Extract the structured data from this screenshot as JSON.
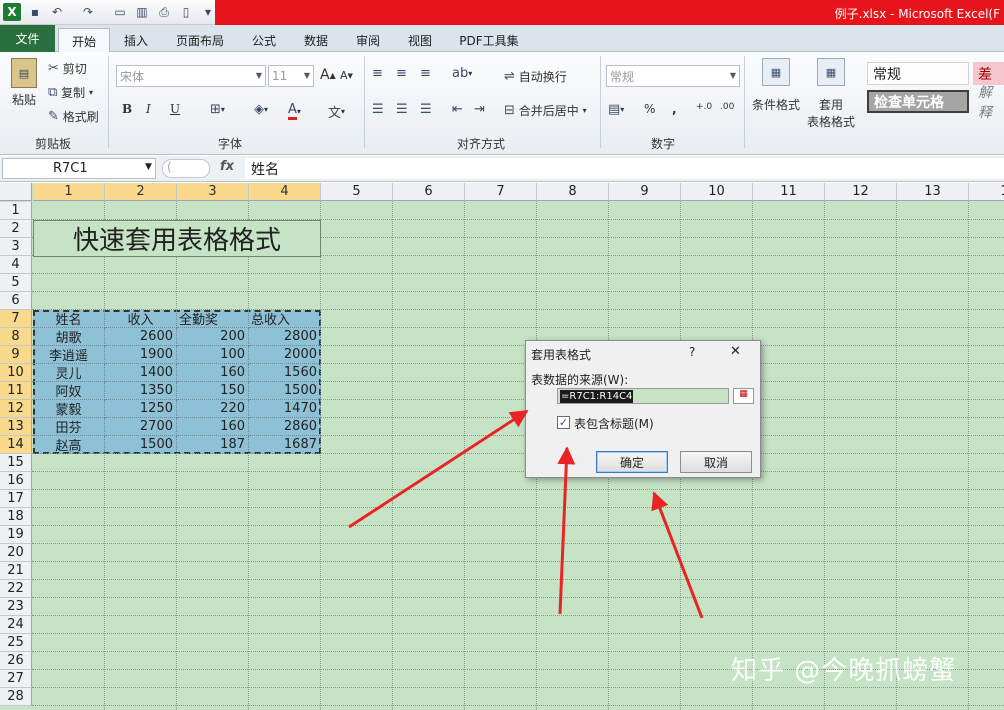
{
  "window": {
    "title": "例子.xlsx - Microsoft Excel(F"
  },
  "tabs": [
    "文件",
    "开始",
    "插入",
    "页面布局",
    "公式",
    "数据",
    "审阅",
    "视图",
    "PDF工具集"
  ],
  "active_tab": "开始",
  "ribbon": {
    "clipboard": {
      "paste": "粘贴",
      "cut": "剪切",
      "copy": "复制",
      "format_painter": "格式刷",
      "label": "剪贴板"
    },
    "font": {
      "name": "宋体",
      "size": "11",
      "bold": "B",
      "italic": "I",
      "underline": "U",
      "label": "字体"
    },
    "alignment": {
      "wrap": "自动换行",
      "merge": "合并后居中",
      "label": "对齐方式"
    },
    "number": {
      "format": "常规",
      "percent": "%",
      "comma": ",",
      "label": "数字"
    },
    "styles": {
      "conditional": "条件格式",
      "table_format_line1": "套用",
      "table_format_line2": "表格格式",
      "normal": "常规",
      "bad": "差",
      "check_cell": "检查单元格",
      "explanatory": "解释"
    }
  },
  "formula_bar": {
    "name_box": "R7C1",
    "fx": "fx",
    "content": "姓名"
  },
  "columns": [
    "1",
    "2",
    "3",
    "4",
    "5",
    "6",
    "7",
    "8",
    "9",
    "10",
    "11",
    "12",
    "13",
    "1"
  ],
  "rows": [
    "1",
    "2",
    "3",
    "4",
    "5",
    "6",
    "7",
    "8",
    "9",
    "10",
    "11",
    "12",
    "13",
    "14",
    "15",
    "16",
    "17",
    "18",
    "19",
    "20",
    "21",
    "22",
    "23",
    "24",
    "25",
    "26",
    "27",
    "28"
  ],
  "sheet": {
    "title": "快速套用表格格式",
    "headers": [
      "姓名",
      "收入",
      "全勤奖",
      "总收入"
    ],
    "data": [
      [
        "胡歌",
        "2600",
        "200",
        "2800"
      ],
      [
        "李逍遥",
        "1900",
        "100",
        "2000"
      ],
      [
        "灵儿",
        "1400",
        "160",
        "1560"
      ],
      [
        "阿奴",
        "1350",
        "150",
        "1500"
      ],
      [
        "蒙毅",
        "1250",
        "220",
        "1470"
      ],
      [
        "田芬",
        "2700",
        "160",
        "2860"
      ],
      [
        "赵高",
        "1500",
        "187",
        "1687"
      ]
    ]
  },
  "dialog": {
    "title": "套用表格式",
    "help": "?",
    "close": "✕",
    "source_label": "表数据的来源(W):",
    "range": "=R7C1:R14C4",
    "has_headers_label": "表包含标题(M)",
    "has_headers_checked": true,
    "ok": "确定",
    "cancel": "取消"
  },
  "annotations": {
    "arrow_color": "#e82424",
    "count": 3
  },
  "watermark": "知乎 @今晚抓螃蟹",
  "colors": {
    "sheet_bg": "#c6e3c6",
    "table_fill": "#8fc1d6",
    "selected_header": "#f9d98c",
    "title_bar": "#e8141b"
  }
}
